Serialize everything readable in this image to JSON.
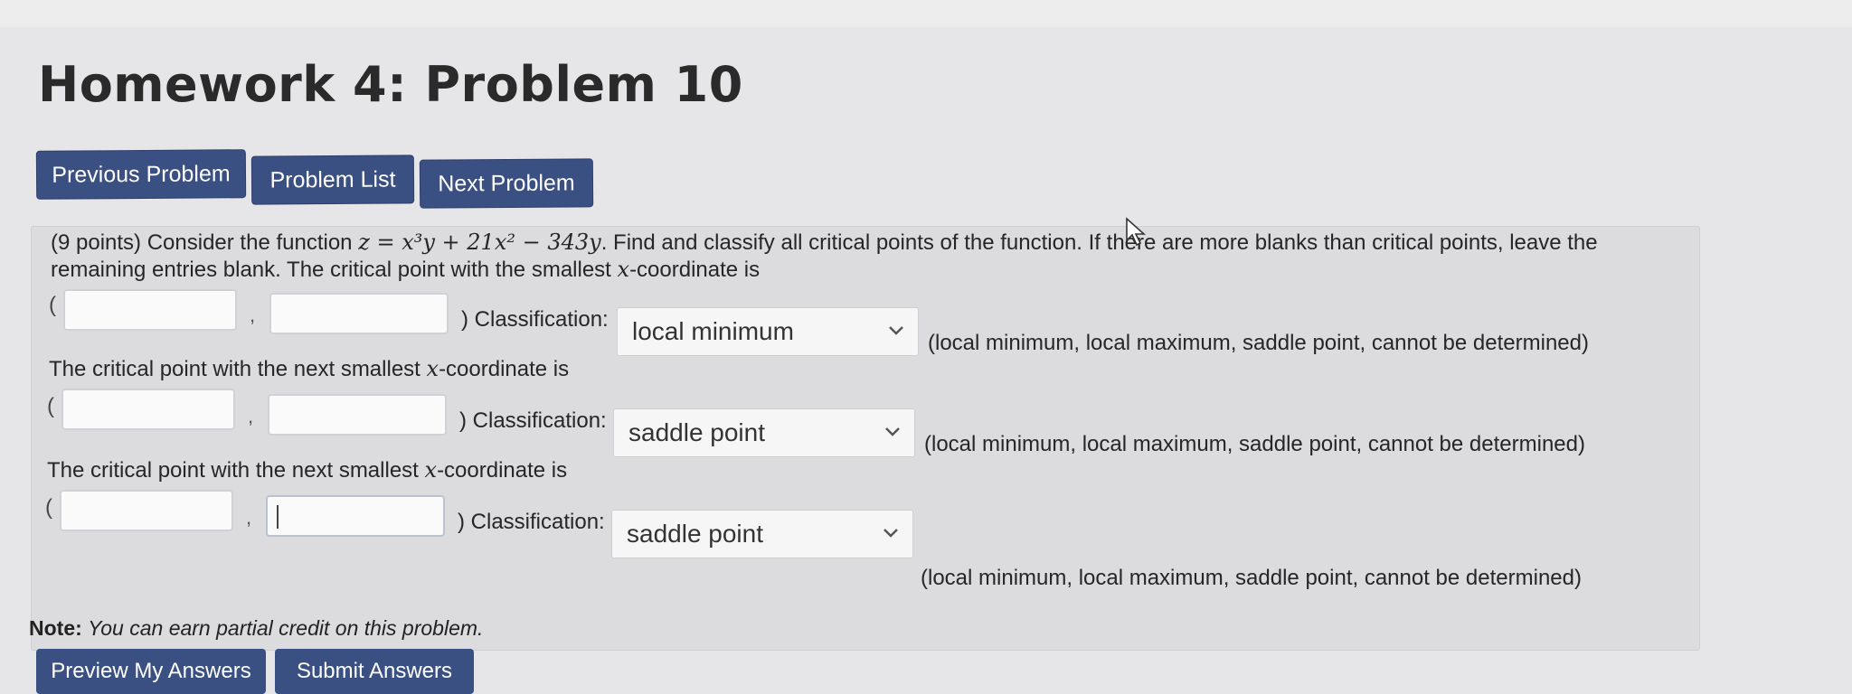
{
  "page": {
    "title": "Homework 4: Problem 10"
  },
  "nav": {
    "previous": "Previous Problem",
    "list": "Problem List",
    "next": "Next Problem"
  },
  "problem": {
    "intro_a": "(9 points) Consider the function ",
    "function_expr": "z = x³y + 21x² − 343y",
    "intro_b": ". Find and classify all critical points of the function. If there are more blanks than critical points, leave the",
    "intro_c": "remaining entries blank. The critical point with the smallest ",
    "x_var": "x",
    "coord_suffix": "-coordinate is",
    "next_prefix": "The critical point with the next smallest ",
    "open_paren": "(",
    "comma": ",",
    "classification_label": ") Classification:",
    "options_hint": "(local minimum, local maximum, saddle point, cannot be determined)",
    "rows": [
      {
        "x_value": "",
        "y_value": "",
        "classification": "local minimum"
      },
      {
        "x_value": "",
        "y_value": "",
        "classification": "saddle point"
      },
      {
        "x_value": "",
        "y_value": "",
        "classification": "saddle point"
      }
    ]
  },
  "note": {
    "label": "Note:",
    "text": "You can earn partial credit on this problem."
  },
  "footer": {
    "preview_button": "Preview My Answers",
    "submit_button": "Submit Answers"
  },
  "colors": {
    "nav_button": "#3a4f82",
    "background": "#e6e6e8",
    "panel": "#dcdcde"
  }
}
